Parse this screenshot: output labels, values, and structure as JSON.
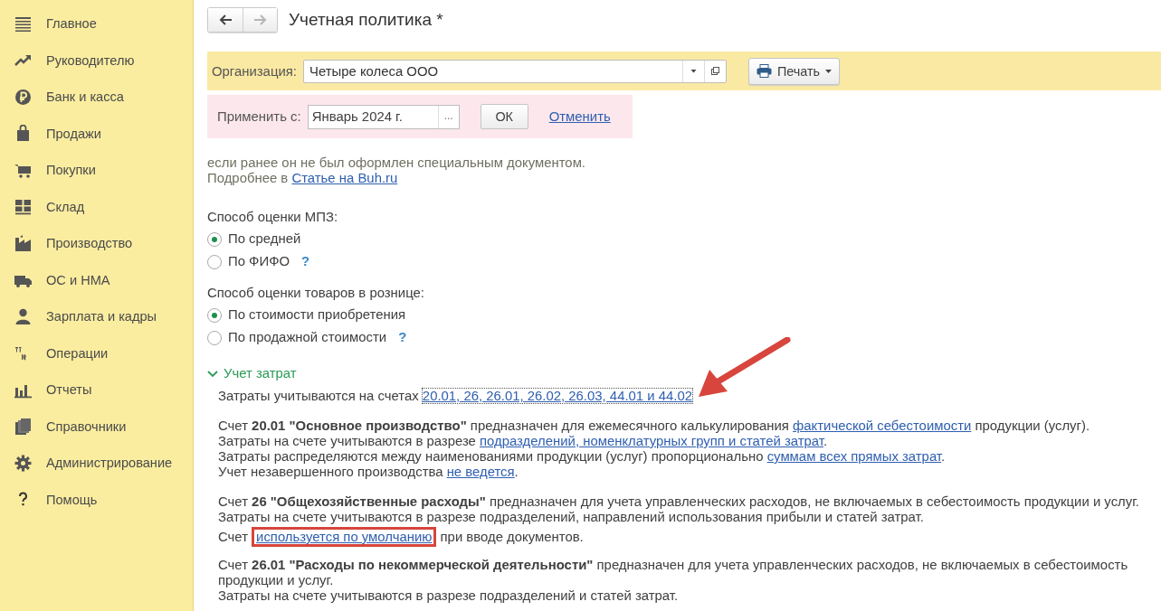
{
  "sidebar": {
    "items": [
      {
        "label": "Главное",
        "kind": "menu"
      },
      {
        "label": "Руководителю",
        "kind": "trend"
      },
      {
        "label": "Банк и касса",
        "kind": "coin"
      },
      {
        "label": "Продажи",
        "kind": "bag"
      },
      {
        "label": "Покупки",
        "kind": "cart"
      },
      {
        "label": "Склад",
        "kind": "grid"
      },
      {
        "label": "Производство",
        "kind": "factory"
      },
      {
        "label": "ОС и НМА",
        "kind": "truck"
      },
      {
        "label": "Зарплата и кадры",
        "kind": "person"
      },
      {
        "label": "Операции",
        "kind": "ledger"
      },
      {
        "label": "Отчеты",
        "kind": "bars"
      },
      {
        "label": "Справочники",
        "kind": "books"
      },
      {
        "label": "Администрирование",
        "kind": "gear"
      },
      {
        "label": "Помощь",
        "kind": "help"
      }
    ]
  },
  "nav": {
    "back_disabled": false,
    "forward_disabled": true
  },
  "title": "Учетная политика *",
  "organization": {
    "label": "Организация:",
    "value": "Четыре колеса ООО"
  },
  "print_button": "Печать",
  "apply": {
    "label": "Применить с:",
    "value": "Январь 2024 г.",
    "choose": "...",
    "ok": "ОК",
    "cancel": "Отменить"
  },
  "content": [
    {
      "kind": "note",
      "lines": [
        [
          {
            "kind": "text",
            "text": "если ранее он не был оформлен специальным документом."
          }
        ],
        [
          {
            "kind": "text",
            "text": "Подробнее в "
          },
          {
            "kind": "link",
            "text": "Статье на Buh.ru"
          }
        ]
      ]
    },
    {
      "kind": "radio_group",
      "label": "Способ оценки МПЗ:",
      "options": [
        {
          "label": "По средней",
          "selected": true
        },
        {
          "label": "По ФИФО",
          "selected": false,
          "help": "?"
        }
      ]
    },
    {
      "kind": "radio_group",
      "label": "Способ оценки товаров в рознице:",
      "options": [
        {
          "label": "По стоимости приобретения",
          "selected": true
        },
        {
          "label": "По продажной стоимости",
          "selected": false,
          "help": "?"
        }
      ]
    },
    {
      "kind": "section",
      "label": "Учет затрат",
      "expanded": true
    },
    {
      "kind": "text",
      "lines": [
        [
          {
            "kind": "text",
            "text": "Затраты учитываются на счетах "
          },
          {
            "kind": "link",
            "text": "20.01, 26, 26.01, 26.02, 26.03, 44.01 и 44.02",
            "focused": true
          }
        ]
      ]
    },
    {
      "kind": "text",
      "lines": [
        [
          {
            "kind": "text",
            "text": "Счет **20.01 \"Основное производство\"** предназначен для ежемесячного калькулирования "
          },
          {
            "kind": "link",
            "text": "фактической себестоимости"
          },
          {
            "kind": "text",
            "text": " продукции (услуг)."
          }
        ],
        [
          {
            "kind": "text",
            "text": "Затраты на счете учитываются в разрезе "
          },
          {
            "kind": "link",
            "text": "подразделений, номенклатурных групп и статей затрат"
          },
          {
            "kind": "text",
            "text": "."
          }
        ],
        [
          {
            "kind": "text",
            "text": "Затраты распределяются между наименованиями продукции (услуг) пропорционально "
          },
          {
            "kind": "link",
            "text": "суммам всех прямых затрат"
          },
          {
            "kind": "text",
            "text": "."
          }
        ],
        [
          {
            "kind": "text",
            "text": "Учет незавершенного производства "
          },
          {
            "kind": "link",
            "text": "не ведется"
          },
          {
            "kind": "text",
            "text": "."
          }
        ]
      ]
    },
    {
      "kind": "text",
      "lines": [
        [
          {
            "kind": "text",
            "text": "Счет **26 \"Общехозяйственные расходы\"** предназначен для учета управленческих расходов, не включаемых в себестоимость продукции и услуг."
          }
        ],
        [
          {
            "kind": "text",
            "text": "Затраты на счете учитываются в разрезе подразделений, направлений использования прибыли и статей затрат."
          }
        ],
        [
          {
            "kind": "text",
            "text": "Счет "
          },
          {
            "kind": "link",
            "text": "используется по умолчанию",
            "highlighted": true
          },
          {
            "kind": "text",
            "text": " при вводе документов."
          }
        ]
      ]
    },
    {
      "kind": "text",
      "lines": [
        [
          {
            "kind": "text",
            "text": "Счет **26.01 \"Расходы по некоммерческой деятельности\"** предназначен для учета управленческих расходов, не включаемых в себестоимость"
          }
        ],
        [
          {
            "kind": "text",
            "text": "продукции и услуг."
          }
        ],
        [
          {
            "kind": "text",
            "text": "Затраты на счете учитываются в разрезе подразделений и статей затрат."
          }
        ]
      ]
    }
  ],
  "annotations": [
    {
      "kind": "arrow"
    }
  ]
}
